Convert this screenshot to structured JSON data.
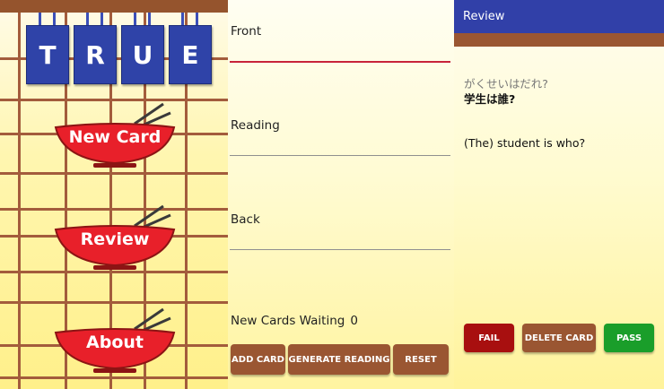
{
  "menu": {
    "logo_letters": [
      "T",
      "R",
      "U",
      "E"
    ],
    "buttons": [
      "New Card",
      "Review",
      "About"
    ]
  },
  "add_card": {
    "fields": [
      "Front",
      "Reading",
      "Back"
    ],
    "waiting_label": "New Cards Waiting",
    "waiting_count": "0",
    "buttons": [
      "ADD CARD",
      "GENERATE READING",
      "RESET"
    ]
  },
  "review": {
    "title": "Review",
    "reading": "がくせいはだれ?",
    "front": "学生は誰?",
    "meaning": "(The) student is who?",
    "buttons": [
      "FAIL",
      "DELETE CARD",
      "PASS"
    ],
    "colors": {
      "fail": "#a80f0f",
      "delete": "#9a5632",
      "pass": "#1a9e2a",
      "appbar": "#3140a8"
    }
  }
}
